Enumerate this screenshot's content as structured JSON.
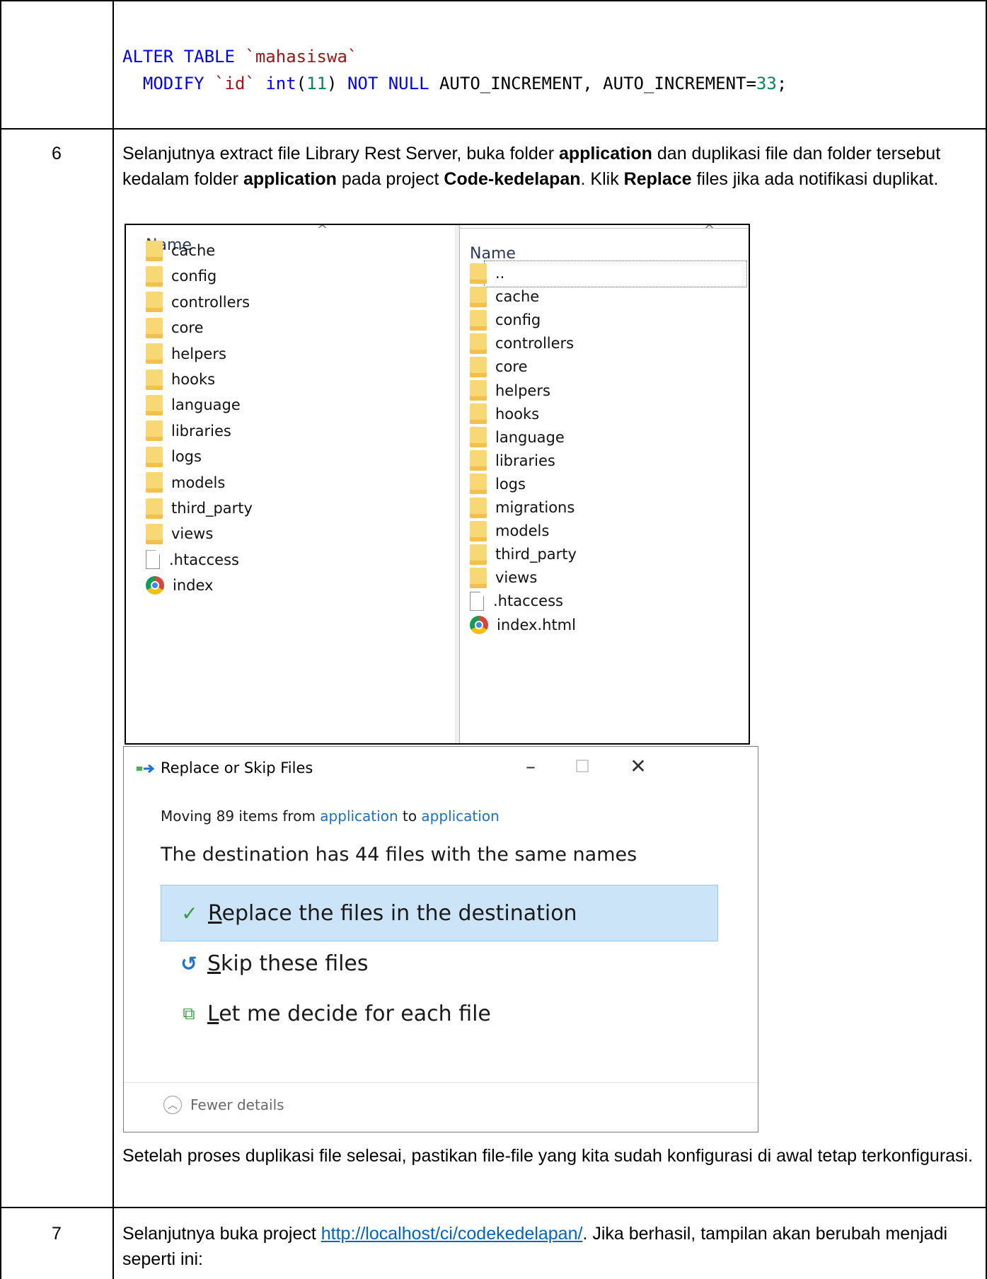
{
  "code": {
    "line1": {
      "kw": "ALTER TABLE",
      "str": "`mahasiswa`"
    },
    "line2": {
      "kw1": "MODIFY",
      "str": "`id`",
      "kw2": "int",
      "p_open": "(",
      "num1": "11",
      "p_close": ")",
      "kw3": "NOT NULL",
      "rest": "AUTO_INCREMENT, AUTO_INCREMENT=",
      "num2": "33",
      "end": ";"
    }
  },
  "step6": {
    "number": "6",
    "intro": {
      "t1": "Selanjutnya extract file Library Rest Server, buka folder ",
      "b1": "application",
      "t2": " dan duplikasi file dan folder tersebut kedalam folder ",
      "b2": "application",
      "t3": " pada project ",
      "b3": "Code-kedelapan",
      "t4": ". Klik ",
      "b4": "Replace",
      "t5": " files jika ada notifikasi duplikat."
    },
    "explorer": {
      "left": {
        "header": "Name",
        "items": [
          "cache",
          "config",
          "controllers",
          "core",
          "helpers",
          "hooks",
          "language",
          "libraries",
          "logs",
          "models",
          "third_party",
          "views"
        ],
        "file": ".htaccess",
        "index": "index"
      },
      "right": {
        "header": "Name",
        "parent": "..",
        "items": [
          "cache",
          "config",
          "controllers",
          "core",
          "helpers",
          "hooks",
          "language",
          "libraries",
          "logs",
          "migrations",
          "models",
          "third_party",
          "views"
        ],
        "file": ".htaccess",
        "index": "index.html"
      }
    },
    "dialog": {
      "title": "Replace or Skip Files",
      "moving_prefix": "Moving 89 items from ",
      "src": "application",
      "mid": " to ",
      "dst": "application",
      "headline": "The destination has 44 files with the same names",
      "opt_replace_u": "R",
      "opt_replace": "eplace the files in the destination",
      "opt_skip_u": "S",
      "opt_skip": "kip these files",
      "opt_decide_u": "L",
      "opt_decide": "et me decide for each file",
      "fewer": "Fewer details"
    },
    "outro": "Setelah proses duplikasi file selesai, pastikan file-file yang kita sudah konfigurasi di awal tetap terkonfigurasi."
  },
  "step7": {
    "number": "7",
    "t1": "Selanjutnya buka project ",
    "link": "http://localhost/ci/codekedelapan/",
    "t2": ". Jika berhasil, tampilan akan berubah menjadi seperti ini:"
  }
}
